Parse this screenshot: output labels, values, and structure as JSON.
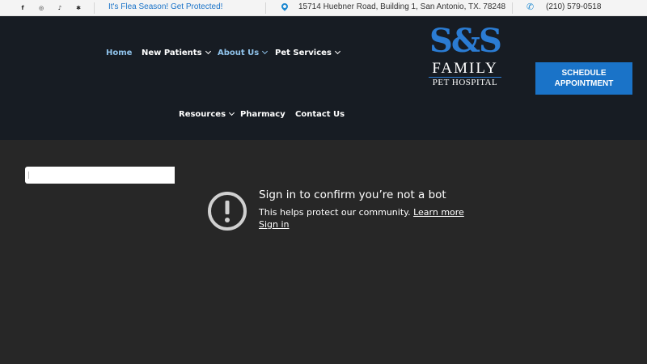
{
  "topbar": {
    "social": [
      {
        "name": "facebook-icon",
        "glyph": "f"
      },
      {
        "name": "instagram-icon",
        "glyph": "◎"
      },
      {
        "name": "tiktok-icon",
        "glyph": "♪"
      },
      {
        "name": "yelp-icon",
        "glyph": "✱"
      }
    ],
    "promo": "It's Flea Season! Get Protected!",
    "address": "15714 Huebner Road, Building 1, San Antonio, TX. 78248",
    "phone": "(210) 579-0518"
  },
  "nav": {
    "items": [
      {
        "label": "Home"
      },
      {
        "label": "New Patients"
      },
      {
        "label": "About Us"
      },
      {
        "label": "Pet Services"
      },
      {
        "label": "Resources"
      },
      {
        "label": "Pharmacy"
      },
      {
        "label": "Contact Us"
      }
    ]
  },
  "logo": {
    "mark": "S&S",
    "line1": "FAMILY",
    "line2": "PET HOSPITAL"
  },
  "schedule_button": {
    "line1": "SCHEDULE",
    "line2": "APPOINTMENT"
  },
  "notice": {
    "title": "Sign in to confirm you’re not a bot",
    "body": "This helps protect our community.",
    "learn_more": "Learn more",
    "sign_in": "Sign in"
  },
  "colors": {
    "header_bg": "#171c23",
    "content_bg": "#272727",
    "accent_blue": "#1a73c8",
    "nav_active": "#8fc2ea"
  }
}
